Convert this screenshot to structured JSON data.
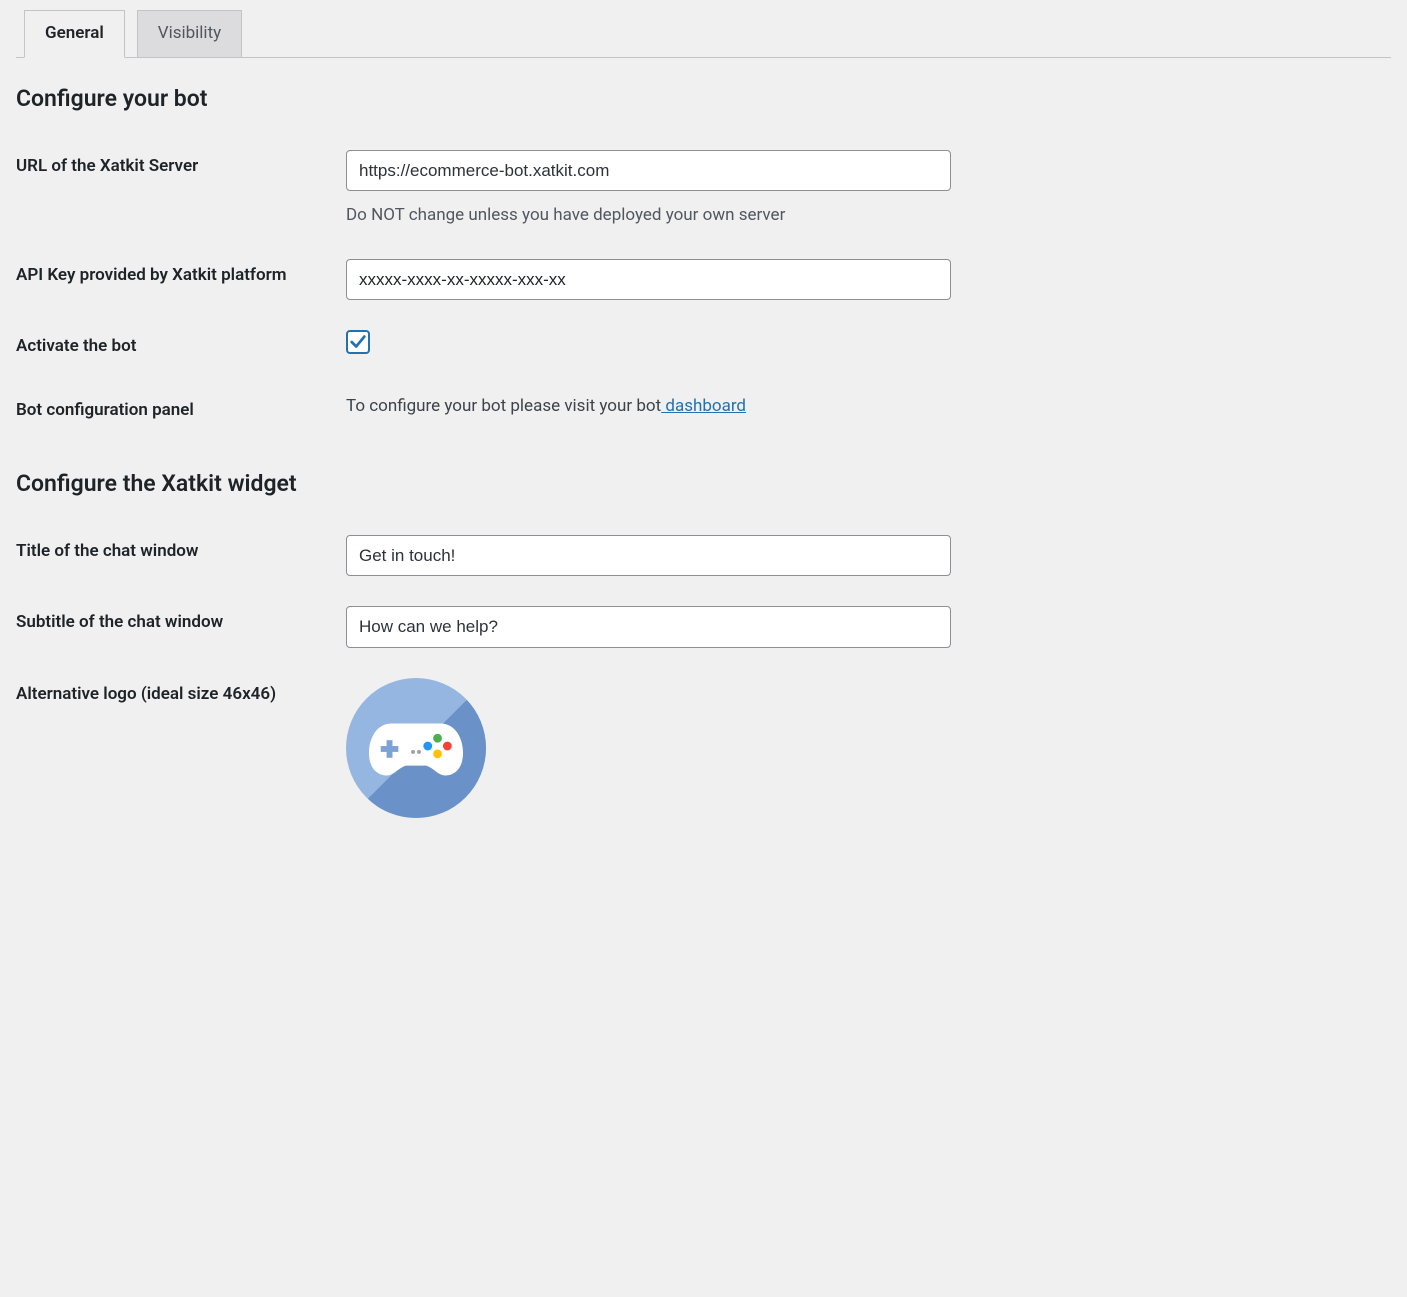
{
  "tabs": {
    "general": "General",
    "visibility": "Visibility"
  },
  "sections": {
    "configure_bot_title": "Configure your bot",
    "configure_widget_title": "Configure the Xatkit widget"
  },
  "fields": {
    "server_url": {
      "label": "URL of the Xatkit Server",
      "value": "https://ecommerce-bot.xatkit.com",
      "description": "Do NOT change unless you have deployed your own server"
    },
    "api_key": {
      "label": "API Key provided by Xatkit platform",
      "placeholder": "xxxxx-xxxx-xx-xxxxx-xxx-xx",
      "value": ""
    },
    "activate": {
      "label": "Activate the bot"
    },
    "config_panel": {
      "label": "Bot configuration panel",
      "text_prefix": "To configure your bot please visit your bot",
      "link_text": " dashboard"
    },
    "chat_title": {
      "label": "Title of the chat window",
      "value": "Get in touch!"
    },
    "chat_subtitle": {
      "label": "Subtitle of the chat window",
      "value": "How can we help?"
    },
    "alt_logo": {
      "label": "Alternative logo (ideal size 46x46)"
    }
  }
}
